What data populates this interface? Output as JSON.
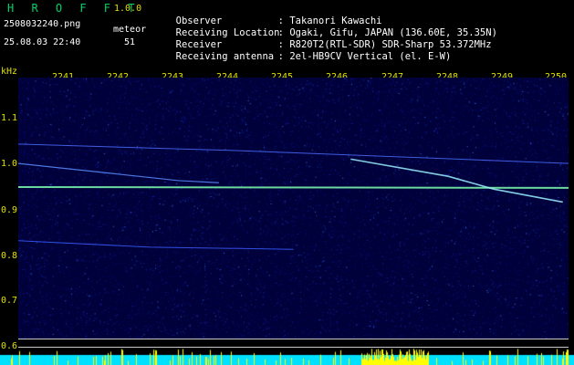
{
  "app": {
    "name": "H R O F F T",
    "version": "1.0.0",
    "filename": "2508032240.png",
    "datetime": "25.08.03 22:40",
    "meteor_label": "meteor",
    "meteor_count": "51"
  },
  "info": [
    {
      "key": "Observer",
      "sep": ":",
      "value": "Takanori Kawachi"
    },
    {
      "key": "Receiving Location",
      "sep": ":",
      "value": "Ogaki, Gifu, JAPAN (136.60E, 35.35N)"
    },
    {
      "key": "Receiver",
      "sep": ":",
      "value": "R820T2(RTL-SDR) SDR-Sharp 53.372MHz"
    },
    {
      "key": "Receiving antenna",
      "sep": ":",
      "value": "2el-HB9CV Vertical (el. E-W)"
    }
  ],
  "x_axis": {
    "ticks": [
      "2241",
      "2242",
      "2243",
      "2244",
      "2245",
      "2246",
      "2247",
      "2248",
      "2249",
      "2250"
    ]
  },
  "y_axis": {
    "unit": "kHz",
    "ticks": [
      "1.1",
      "1.0",
      "0.9",
      "0.8",
      "0.7",
      "0.6"
    ]
  },
  "colors": {
    "background": "#000000",
    "plot_bg": "#00003a",
    "title_green": "#00d26a",
    "axis_yellow": "#e0e000",
    "strip_cyan": "#00e0ff",
    "strip_yellow": "#ffff00"
  },
  "chart_data": {
    "type": "scatter",
    "xlabel": "",
    "ylabel": "kHz",
    "xlim": [
      2240.7,
      2250.3
    ],
    "ylim": [
      0.58,
      1.19
    ],
    "series": [
      {
        "points": [
          [
            2240.7,
            0.935
          ],
          [
            2250.3,
            0.933
          ]
        ]
      },
      {
        "points": [
          [
            2240.7,
            1.035
          ],
          [
            2244.5,
            1.02
          ],
          [
            2250.3,
            0.99
          ]
        ]
      },
      {
        "points": [
          [
            2240.7,
            0.99
          ],
          [
            2243.5,
            0.95
          ],
          [
            2244.2,
            0.945
          ]
        ]
      },
      {
        "points": [
          [
            2246.5,
            1.0
          ],
          [
            2248.2,
            0.96
          ],
          [
            2249.0,
            0.93
          ],
          [
            2250.2,
            0.9
          ]
        ]
      },
      {
        "points": [
          [
            2240.7,
            0.81
          ],
          [
            2243.0,
            0.795
          ],
          [
            2245.5,
            0.79
          ]
        ]
      }
    ]
  }
}
